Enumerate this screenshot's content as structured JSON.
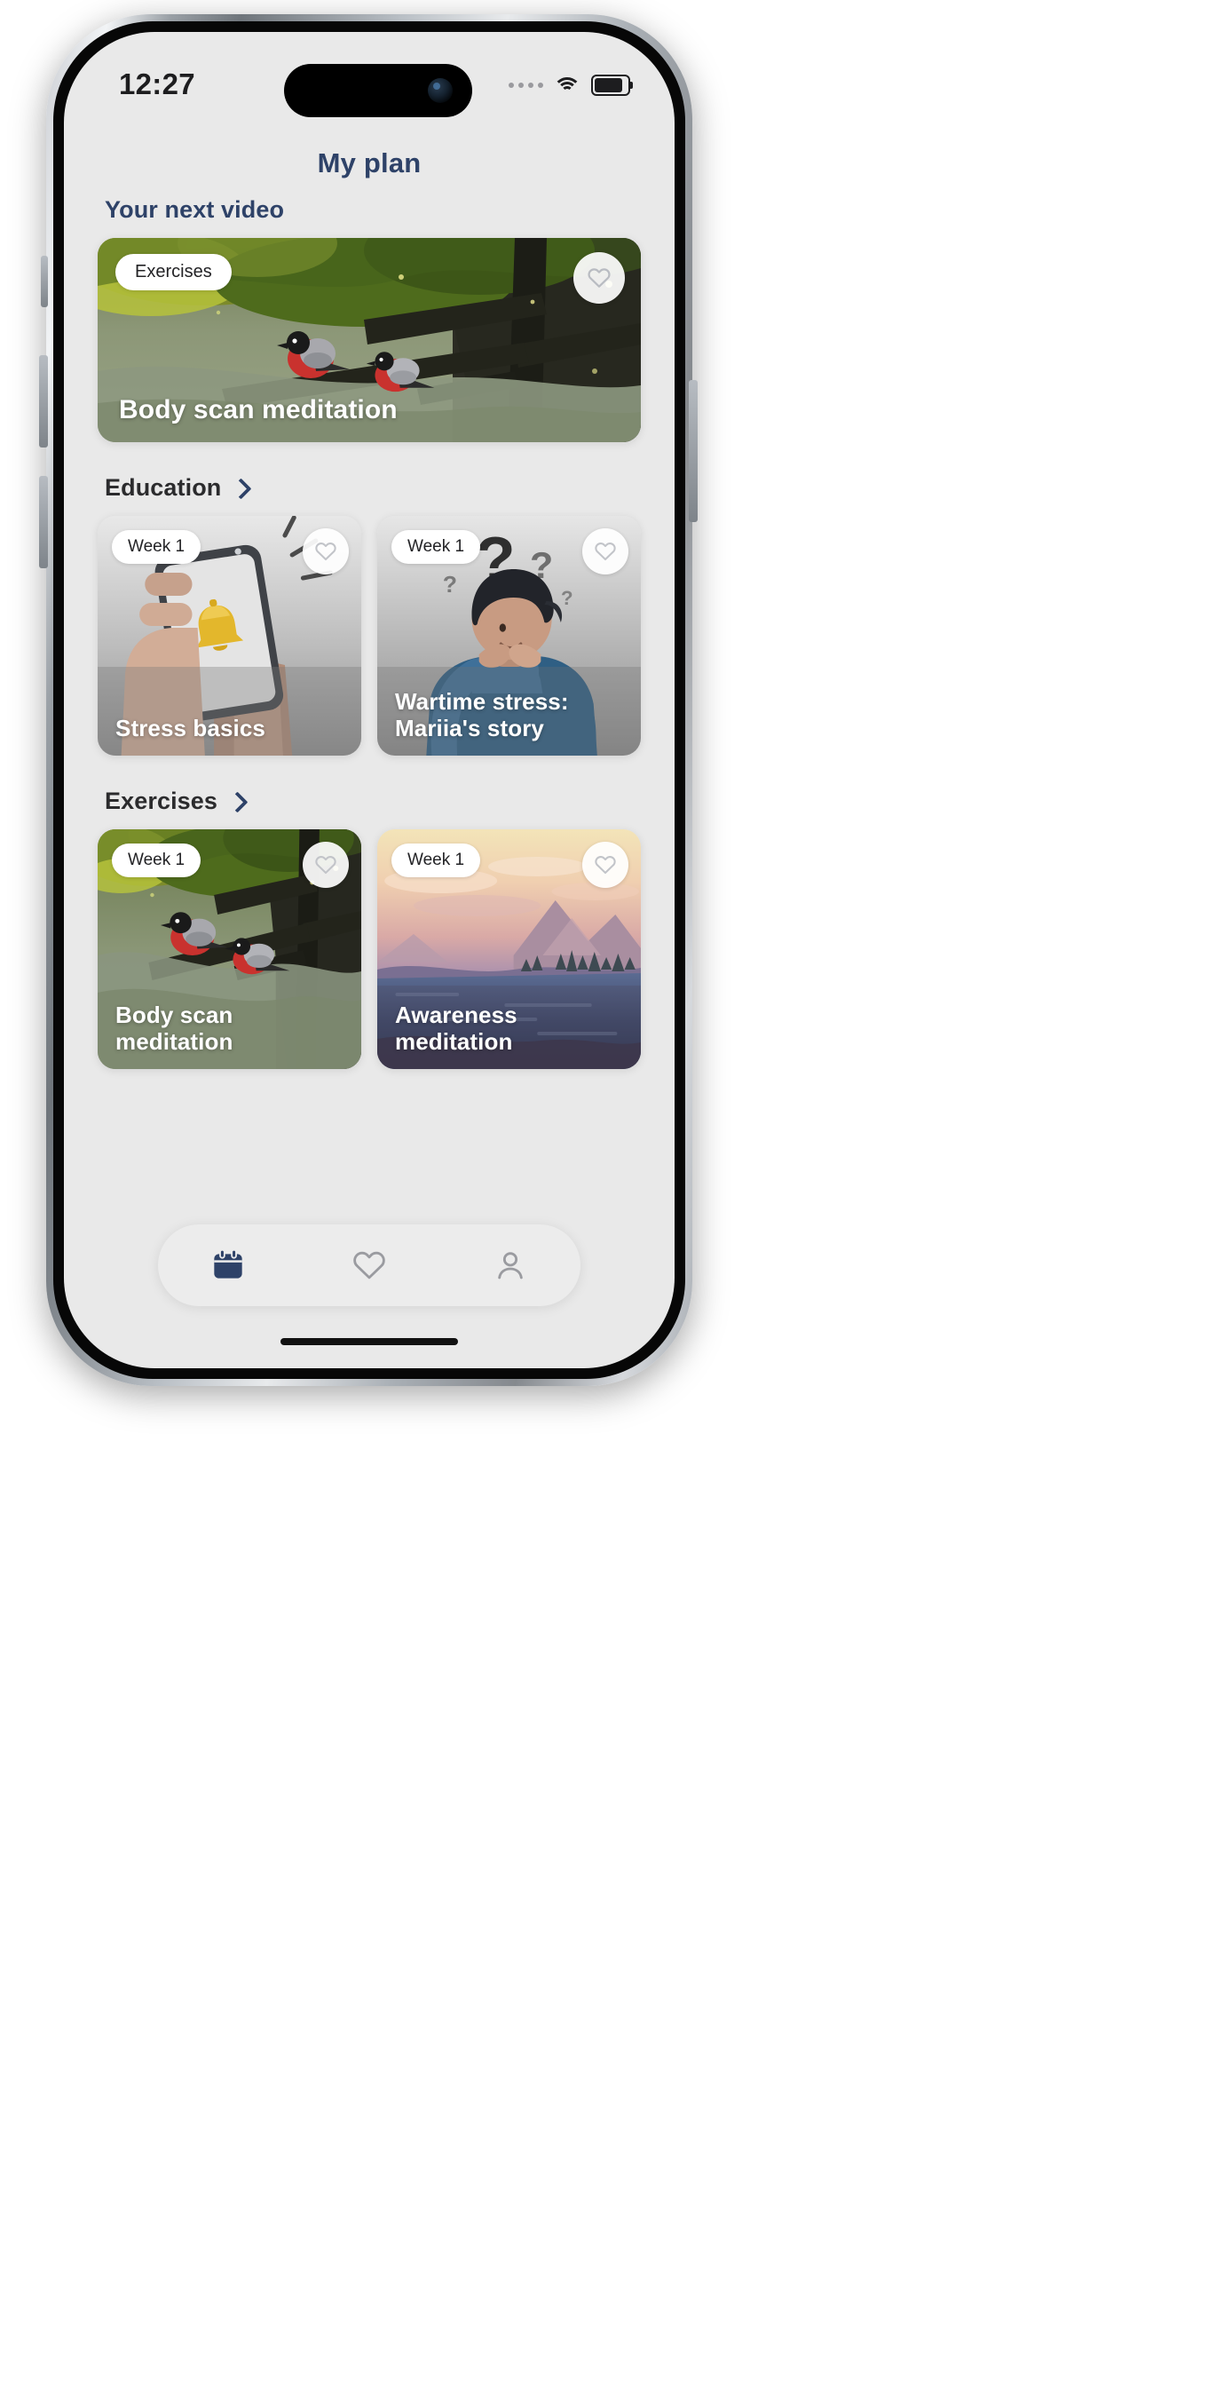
{
  "status_bar": {
    "time": "12:27",
    "icons": [
      "signal-dots-icon",
      "wifi-icon",
      "battery-icon"
    ]
  },
  "header": {
    "title": "My plan"
  },
  "sections": [
    {
      "id": "next-video",
      "title": "Your next video",
      "has_chevron": false,
      "title_color": "#2e4268"
    },
    {
      "id": "education",
      "title": "Education",
      "has_chevron": true,
      "title_color": "#2b2b2d"
    },
    {
      "id": "exercises",
      "title": "Exercises",
      "has_chevron": true,
      "title_color": "#2b2b2d"
    }
  ],
  "hero_card": {
    "badge": "Exercises",
    "title": "Body scan meditation",
    "favorite_icon": "heart-icon",
    "favorited": false,
    "art": "forest-bullfinch-birds"
  },
  "education_cards": [
    {
      "badge": "Week 1",
      "title": "Stress basics",
      "favorite_icon": "heart-icon",
      "favorited": false,
      "art": "hand-holding-phone-with-bell"
    },
    {
      "badge": "Week 1",
      "title": "Wartime stress: Mariia's story",
      "favorite_icon": "heart-icon",
      "favorited": false,
      "art": "person-holding-head-question-marks"
    }
  ],
  "exercise_cards": [
    {
      "badge": "Week 1",
      "title": "Body scan meditation",
      "favorite_icon": "heart-icon",
      "favorited": false,
      "art": "forest-bullfinch-birds"
    },
    {
      "badge": "Week 1",
      "title": "Awareness meditation",
      "favorite_icon": "heart-icon",
      "favorited": false,
      "art": "sunset-mountains-lake"
    }
  ],
  "tab_bar": {
    "items": [
      {
        "icon": "calendar-icon",
        "active": true
      },
      {
        "icon": "heart-icon",
        "active": false
      },
      {
        "icon": "person-icon",
        "active": false
      }
    ],
    "active_color": "#2e4268",
    "inactive_color": "#9a9ba0"
  }
}
